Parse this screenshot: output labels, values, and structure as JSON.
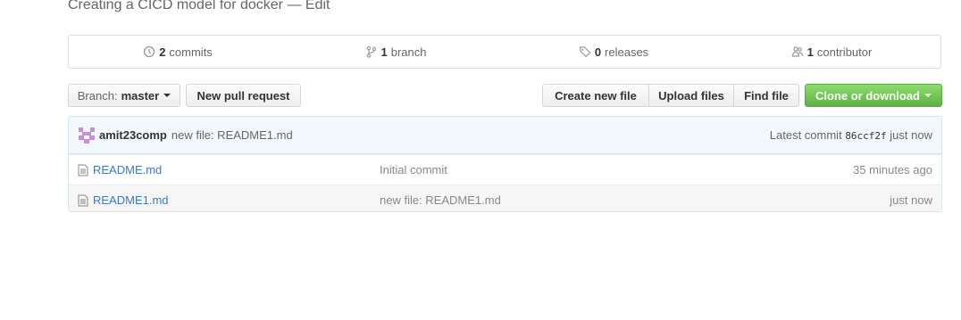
{
  "repo": {
    "description": "Creating a CICD model for docker",
    "separator": "—",
    "edit_label": "Edit"
  },
  "summary": {
    "commits": {
      "count": "2",
      "label": "commits",
      "icon": "history-icon"
    },
    "branches": {
      "count": "1",
      "label": "branch",
      "icon": "git-branch-icon"
    },
    "releases": {
      "count": "0",
      "label": "releases",
      "icon": "tag-icon"
    },
    "contributors": {
      "count": "1",
      "label": "contributor",
      "icon": "people-icon"
    }
  },
  "toolbar": {
    "branch_prefix": "Branch:",
    "branch_name": "master",
    "new_pull_request": "New pull request",
    "create_new_file": "Create new file",
    "upload_files": "Upload files",
    "find_file": "Find file",
    "clone_or_download": "Clone or download"
  },
  "commit_bar": {
    "author": "amit23comp",
    "message": "new file: README1.md",
    "latest_label": "Latest commit",
    "sha": "86ccf2f",
    "time": "just now"
  },
  "files": [
    {
      "name": "README.md",
      "message": "Initial commit",
      "age": "35 minutes ago"
    },
    {
      "name": "README1.md",
      "message": "new file: README1.md",
      "age": "just now"
    }
  ],
  "colors": {
    "link": "#4078c0",
    "clone_green": "#60b044",
    "commit_bar_bg": "#f2f9fc"
  }
}
